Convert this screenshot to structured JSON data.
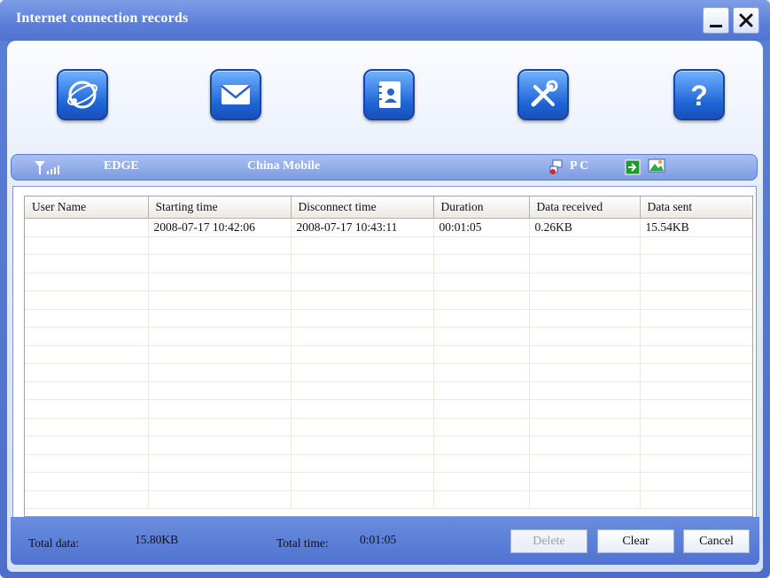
{
  "window": {
    "title": "Internet connection records",
    "min_label": "_",
    "close_label": "✕"
  },
  "toolbar": {
    "icons": [
      "globe-connect-icon",
      "mail-icon",
      "contacts-icon",
      "settings-tools-icon",
      "help-icon"
    ]
  },
  "status": {
    "network": "EDGE",
    "operator": "China Mobile",
    "mode": "P C"
  },
  "table": {
    "columns": [
      "User Name",
      "Starting time",
      "Disconnect time",
      "Duration",
      "Data received",
      "Data sent"
    ],
    "rows": [
      [
        "",
        "2008-07-17  10:42:06",
        "2008-07-17  10:43:11",
        "00:01:05",
        "0.26KB",
        "15.54KB"
      ]
    ]
  },
  "footer": {
    "total_data_label": "Total data:",
    "total_data_value": "15.80KB",
    "total_time_label": "Total time:",
    "total_time_value": "0:01:05",
    "delete_label": "Delete",
    "clear_label": "Clear",
    "cancel_label": "Cancel"
  },
  "colors": {
    "title_bar": "#5b7fd8",
    "button_blue": "#1e63d6",
    "status_bar": "#8aa6e8"
  }
}
